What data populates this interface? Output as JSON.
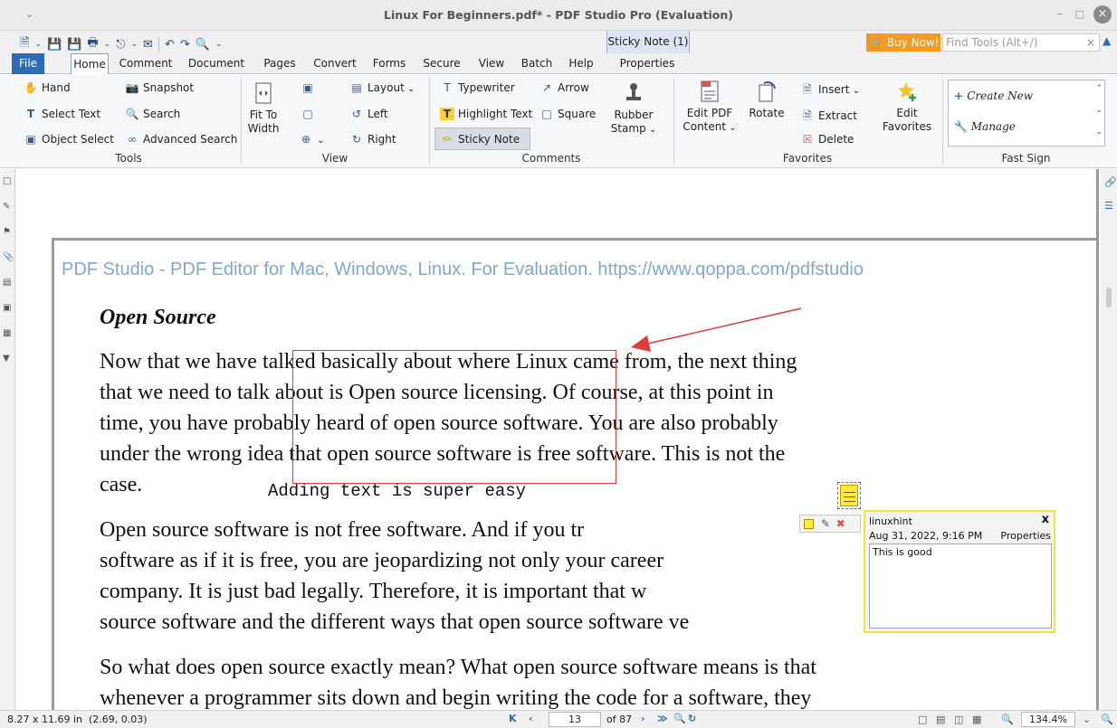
{
  "window": {
    "title": "Linux For Beginners.pdf* - PDF Studio Pro (Evaluation)"
  },
  "quick_access": {
    "context_tab": "Sticky Note (1)",
    "buy_now": "Buy Now!",
    "find_tools_placeholder": "Find Tools  (Alt+/)"
  },
  "tabs": [
    "File",
    "Home",
    "Comment",
    "Document",
    "Pages",
    "Convert",
    "Forms",
    "Secure",
    "View",
    "Batch",
    "Help",
    "Properties"
  ],
  "ribbon": {
    "tools": {
      "label": "Tools",
      "hand": "Hand",
      "select_text": "Select Text",
      "object_select": "Object Select",
      "snapshot": "Snapshot",
      "search": "Search",
      "advanced_search": "Advanced Search"
    },
    "view": {
      "label": "View",
      "fit_to": "Fit To",
      "width": "Width",
      "layout": "Layout",
      "left": "Left",
      "right": "Right"
    },
    "comments": {
      "label": "Comments",
      "typewriter": "Typewriter",
      "highlight_text": "Highlight Text",
      "sticky_note": "Sticky Note",
      "arrow": "Arrow",
      "square": "Square",
      "rubber": "Rubber",
      "stamp": "Stamp"
    },
    "favorites": {
      "label": "Favorites",
      "edit_pdf": "Edit PDF",
      "content": "Content",
      "rotate": "Rotate",
      "insert": "Insert",
      "extract": "Extract",
      "delete": "Delete",
      "edit": "Edit",
      "favorites": "Favorites"
    },
    "fast_sign": {
      "label": "Fast Sign",
      "create_new": "Create New",
      "manage": "Manage"
    }
  },
  "document": {
    "watermark": "PDF Studio - PDF Editor for Mac, Windows, Linux. For Evaluation. https://www.qoppa.com/pdfstudio",
    "heading": "Open Source",
    "para1": [
      "Now that we have talked basically about where Linux came from, the next thing",
      "that we need to talk about is Open source licensing. Of course, at this point in",
      "time, you have probably heard of open source software. You are also probably",
      "under the wrong idea that open source software is free software. This is not the",
      "case."
    ],
    "typewriter_text": "Adding text is super easy",
    "para2": [
      "Open source software is not free software. And if you tr",
      "software as if it is free, you are jeopardizing not only your career",
      "company. It is just bad legally. Therefore, it is important that w",
      "source software and the different ways that open source software ve"
    ],
    "para3": [
      "So what does open source exactly mean? What open source software means is that",
      "whenever a programmer sits down and begin writing the code for a software, they"
    ]
  },
  "note": {
    "author": "linuxhint",
    "date": "Aug 31, 2022, 9:16 PM",
    "properties": "Properties",
    "close": "x",
    "text": "This is good"
  },
  "status": {
    "page_size": "8.27 x 11.69 in",
    "coords": "(2.69, 0.03)",
    "current_page": "13",
    "total_pages": "of 87",
    "zoom": "134.4%"
  },
  "colors": {
    "accent": "#2d6bb5",
    "buy_now": "#f39a1f",
    "annotation_red": "#e23a3a",
    "sticky_yellow": "#ffe93a",
    "watermark": "#7fa8d0"
  }
}
